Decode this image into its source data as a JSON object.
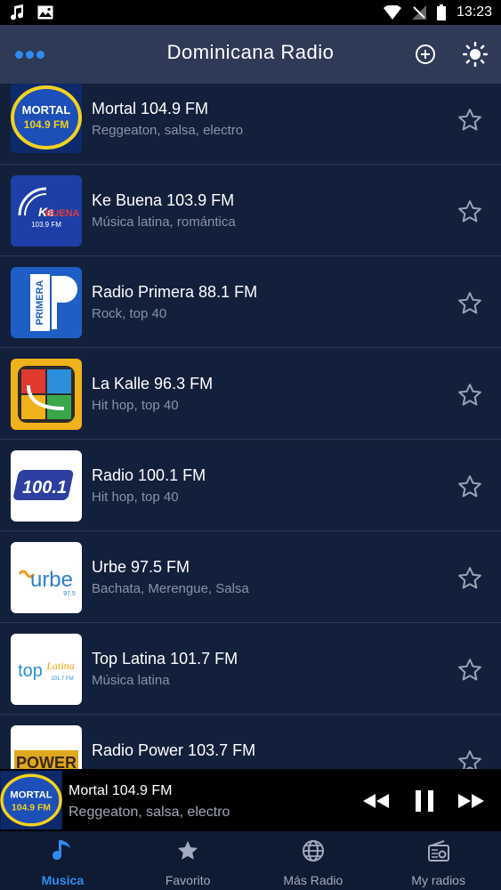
{
  "app_bar": {
    "title": "Dominicana Radio",
    "menu_icon": "more-horizontal-icon",
    "add_icon": "add-circle-icon",
    "theme_icon": "sun-icon"
  },
  "status_bar": {
    "time": "13:23",
    "icons": [
      "music-notification-icon",
      "image-notification-icon",
      "wifi-icon",
      "no-signal-icon",
      "battery-icon"
    ]
  },
  "stations": [
    {
      "name": "Mortal 104.9 FM",
      "genre": "Reggeaton, salsa, electro",
      "logo_text": "MORTAL 104.9 FM"
    },
    {
      "name": "Ke Buena 103.9 FM",
      "genre": "Música latina, romántica",
      "logo_text": "KE BUENA 103.9 FM"
    },
    {
      "name": "Radio Primera 88.1 FM",
      "genre": "Rock, top 40",
      "logo_text": "PRIMERA"
    },
    {
      "name": "La Kalle 96.3 FM",
      "genre": "Hit hop, top 40",
      "logo_text": ""
    },
    {
      "name": "Radio 100.1 FM",
      "genre": "Hit hop, top 40",
      "logo_text": "100.1"
    },
    {
      "name": "Urbe 97.5 FM",
      "genre": "Bachata, Merengue, Salsa",
      "logo_text": "urbe 97.5"
    },
    {
      "name": "Top Latina 101.7 FM",
      "genre": "Música latina",
      "logo_text": "top Latina 101.7 FM"
    },
    {
      "name": "Radio Power 103.7 FM",
      "genre": "",
      "logo_text": "POWER"
    }
  ],
  "player": {
    "title": "Mortal 104.9 FM",
    "genre": "Reggeaton, salsa, electro",
    "logo_text": "MORTAL 104.9 FM"
  },
  "bottom_nav": [
    {
      "label": "Musica",
      "icon": "music-note-icon",
      "active": true
    },
    {
      "label": "Favorito",
      "icon": "star-icon",
      "active": false
    },
    {
      "label": "Más Radio",
      "icon": "globe-icon",
      "active": false
    },
    {
      "label": "My radios",
      "icon": "radio-icon",
      "active": false
    }
  ],
  "colors": {
    "accent": "#2f8df0",
    "background": "#13203b",
    "app_bar": "#2f3a57",
    "muted_text": "#8892a8"
  }
}
